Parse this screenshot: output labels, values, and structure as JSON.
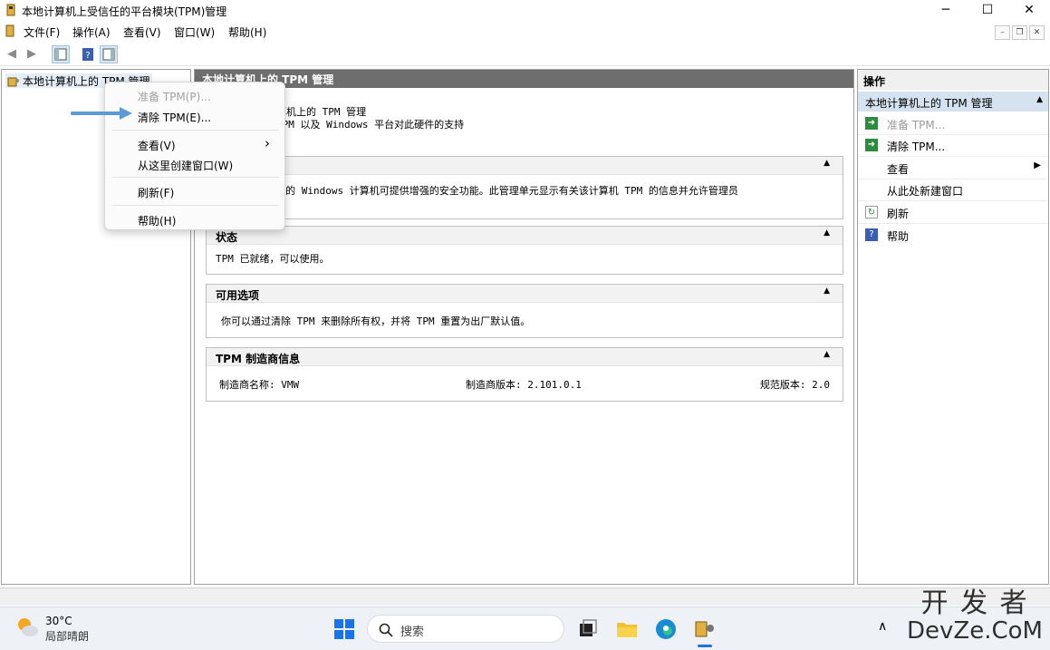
{
  "window": {
    "title": "本地计算机上受信任的平台模块(TPM)管理",
    "min": "─",
    "max": "☐",
    "close": "✕"
  },
  "menu": [
    "文件(F)",
    "操作(A)",
    "查看(V)",
    "窗口(W)",
    "帮助(H)"
  ],
  "mdi": {
    "min": "–",
    "restore": "❐",
    "close": "✕"
  },
  "toolbar": {
    "back": "◀",
    "forward": "▶",
    "help": "?"
  },
  "tree": {
    "root_label": "本地计算机上的 TPM 管理"
  },
  "content": {
    "header": "本地计算机上的 TPM 管理",
    "intro_line1": "算机上的 TPM 管理",
    "intro_line2": "TPM 以及 Windows 平台对此硬件的支持",
    "overview_text": "平台模块(TPM)的 Windows 计算机可提供增强的安全功能。此管理单元显示有关该计算机 TPM 的信息并允许管理员",
    "status_title": "状态",
    "status_text": "TPM 已就绪，可以使用。",
    "options_title": "可用选项",
    "options_text": "你可以通过清除 TPM 来删除所有权，并将 TPM 重置为出厂默认值。",
    "mfr_title": "TPM 制造商信息",
    "mfr_name": "制造商名称: VMW",
    "mfr_version": "制造商版本: 2.101.0.1",
    "spec_version": "规范版本: 2.0",
    "collapse_glyph": "▲"
  },
  "actions": {
    "title": "操作",
    "section": "本地计算机上的 TPM 管理",
    "items": [
      {
        "label": "准备 TPM...",
        "icon": "run-icon",
        "disabled": true
      },
      {
        "label": "清除 TPM...",
        "icon": "run-icon",
        "disabled": false
      },
      {
        "label": "查看",
        "icon": "",
        "submenu": true
      },
      {
        "label": "从此处新建窗口",
        "icon": ""
      },
      {
        "label": "刷新",
        "icon": "refresh-icon"
      },
      {
        "label": "帮助",
        "icon": "help-icon"
      }
    ]
  },
  "context_menu": {
    "items": [
      {
        "label": "准备 TPM(P)...",
        "disabled": true
      },
      {
        "label": "清除 TPM(E)...",
        "disabled": false
      },
      {
        "label": "查看(V)",
        "submenu": true
      },
      {
        "label": "从这里创建窗口(W)"
      },
      {
        "label": "刷新(F)"
      },
      {
        "label": "帮助(H)"
      }
    ],
    "submenu_glyph": "›"
  },
  "taskbar": {
    "weather_temp": "30°C",
    "weather_desc": "局部晴朗",
    "search_placeholder": "搜索",
    "tray_up": "∧"
  },
  "watermark": {
    "line1": "开 发 者",
    "line2": "DevZe.CoM"
  },
  "colors": {
    "accent_arrow": "#5b9bd5",
    "action_green": "#2e8b3e",
    "header_gray": "#6e6e6e"
  }
}
